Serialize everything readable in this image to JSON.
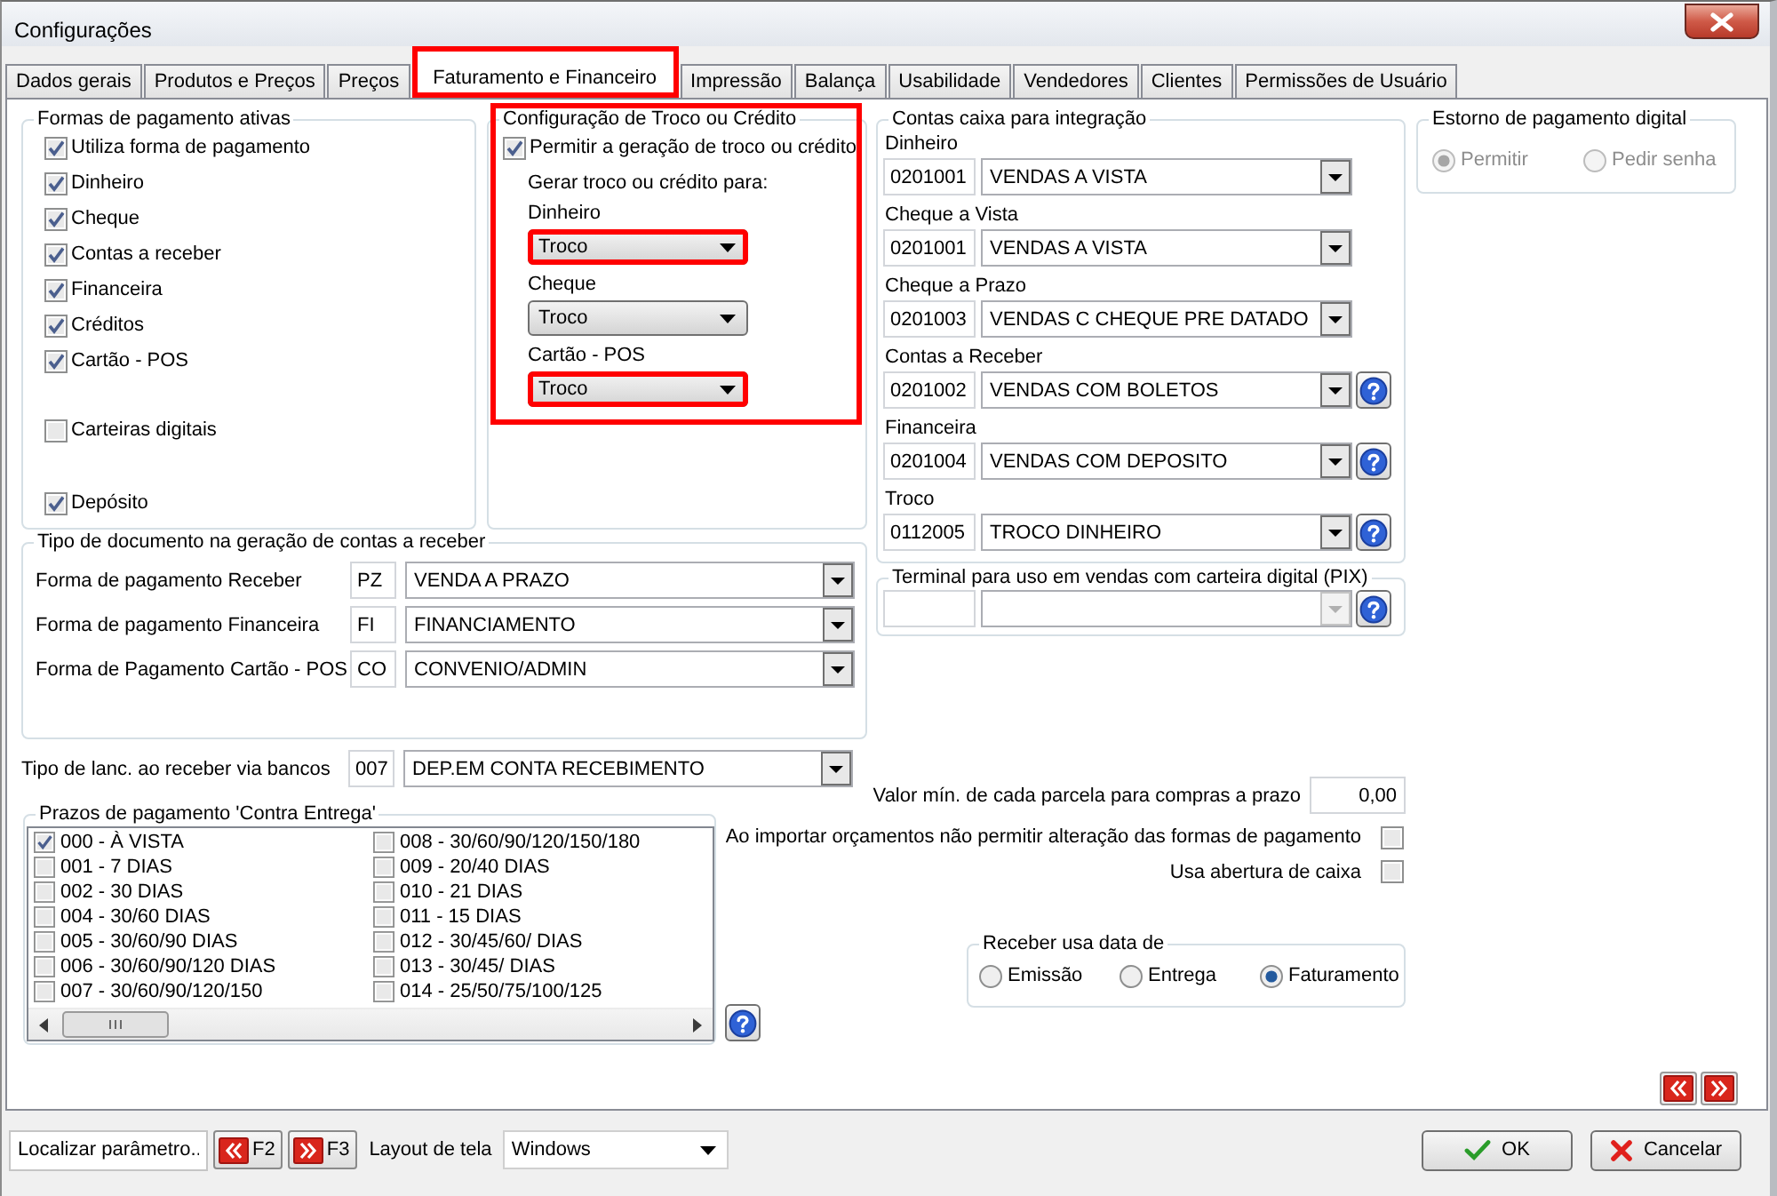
{
  "window": {
    "title": "Configurações"
  },
  "tabs": [
    {
      "label": "Dados gerais",
      "selected": false,
      "highlighted": false
    },
    {
      "label": "Produtos e Preços",
      "selected": false,
      "highlighted": false
    },
    {
      "label": "Preços",
      "selected": false,
      "highlighted": false
    },
    {
      "label": "Faturamento e Financeiro",
      "selected": true,
      "highlighted": true
    },
    {
      "label": "Impressão",
      "selected": false,
      "highlighted": false
    },
    {
      "label": "Balança",
      "selected": false,
      "highlighted": false
    },
    {
      "label": "Usabilidade",
      "selected": false,
      "highlighted": false
    },
    {
      "label": "Vendedores",
      "selected": false,
      "highlighted": false
    },
    {
      "label": "Clientes",
      "selected": false,
      "highlighted": false
    },
    {
      "label": "Permissões de Usuário",
      "selected": false,
      "highlighted": false
    }
  ],
  "payment_forms": {
    "title": "Formas de pagamento ativas",
    "items": [
      {
        "label": "Utiliza forma de pagamento",
        "checked": true
      },
      {
        "label": "Dinheiro",
        "checked": true
      },
      {
        "label": "Cheque",
        "checked": true
      },
      {
        "label": "Contas a receber",
        "checked": true
      },
      {
        "label": "Financeira",
        "checked": true
      },
      {
        "label": "Créditos",
        "checked": true
      },
      {
        "label": "Cartão - POS",
        "checked": true
      },
      {
        "label": "Carteiras digitais",
        "checked": false
      },
      {
        "label": "Depósito",
        "checked": true
      }
    ]
  },
  "change_config": {
    "title": "Configuração de Troco ou Crédito",
    "highlighted": true,
    "allow": {
      "label": "Permitir a geração de troco ou crédito",
      "checked": true
    },
    "subtitle": "Gerar troco ou crédito para:",
    "fields": [
      {
        "label": "Dinheiro",
        "value": "Troco",
        "highlighted": true
      },
      {
        "label": "Cheque",
        "value": "Troco",
        "highlighted": false
      },
      {
        "label": "Cartão - POS",
        "value": "Troco",
        "highlighted": true
      }
    ]
  },
  "cash_accounts": {
    "title": "Contas caixa para integração",
    "items": [
      {
        "label": "Dinheiro",
        "code": "0201001",
        "account": "VENDAS A VISTA",
        "has_help": false
      },
      {
        "label": "Cheque a Vista",
        "code": "0201001",
        "account": "VENDAS A VISTA",
        "has_help": false
      },
      {
        "label": "Cheque a Prazo",
        "code": "0201003",
        "account": "VENDAS C CHEQUE PRE DATADO",
        "has_help": false
      },
      {
        "label": "Contas a Receber",
        "code": "0201002",
        "account": "VENDAS COM BOLETOS",
        "has_help": true
      },
      {
        "label": "Financeira",
        "code": "0201004",
        "account": "VENDAS COM DEPOSITO",
        "has_help": true
      },
      {
        "label": "Troco",
        "code": "0112005",
        "account": "TROCO DINHEIRO",
        "has_help": true
      }
    ]
  },
  "pix_terminal": {
    "title": "Terminal para uso em vendas com carteira digital (PIX)",
    "disabled": true
  },
  "refund": {
    "title": "Estorno de pagamento digital",
    "disabled": true,
    "options": [
      {
        "label": "Permitir",
        "selected": true
      },
      {
        "label": "Pedir senha",
        "selected": false
      }
    ]
  },
  "document_types": {
    "title": "Tipo de documento na geração de contas a receber",
    "rows": [
      {
        "label": "Forma de pagamento Receber",
        "code": "PZ",
        "value": "VENDA A PRAZO"
      },
      {
        "label": "Forma de pagamento Financeira",
        "code": "FI",
        "value": "FINANCIAMENTO"
      },
      {
        "label": "Forma de Pagamento Cartão - POS",
        "code": "CO",
        "value": "CONVENIO/ADMIN"
      }
    ]
  },
  "bank_entry": {
    "label": "Tipo de lanc. ao receber via bancos",
    "code": "007",
    "value": "DEP.EM CONTA RECEBIMENTO"
  },
  "min_installment": {
    "label": "Valor mín. de cada parcela para compras a prazo",
    "value": "0,00"
  },
  "cod_terms": {
    "title": "Prazos de pagamento 'Contra Entrega'",
    "items": [
      {
        "label": "000 - À VISTA",
        "checked": true
      },
      {
        "label": "001 - 7 DIAS",
        "checked": false
      },
      {
        "label": "002 - 30 DIAS",
        "checked": false
      },
      {
        "label": "004 - 30/60 DIAS",
        "checked": false
      },
      {
        "label": "005 - 30/60/90 DIAS",
        "checked": false
      },
      {
        "label": "006 - 30/60/90/120 DIAS",
        "checked": false
      },
      {
        "label": "007 - 30/60/90/120/150",
        "checked": false
      },
      {
        "label": "008 - 30/60/90/120/150/180",
        "checked": false
      },
      {
        "label": "009 - 20/40 DIAS",
        "checked": false
      },
      {
        "label": "010 - 21 DIAS",
        "checked": false
      },
      {
        "label": "011 - 15 DIAS",
        "checked": false
      },
      {
        "label": "012 - 30/45/60/ DIAS",
        "checked": false
      },
      {
        "label": "013 - 30/45/ DIAS",
        "checked": false
      },
      {
        "label": "014 - 25/50/75/100/125",
        "checked": false
      }
    ]
  },
  "options": [
    {
      "label": "Ao importar orçamentos não permitir alteração das formas de pagamento",
      "checked": false
    },
    {
      "label": "Usa abertura de caixa",
      "checked": false
    }
  ],
  "receive_date": {
    "title": "Receber usa data de",
    "options": [
      {
        "label": "Emissão",
        "selected": false
      },
      {
        "label": "Entrega",
        "selected": false
      },
      {
        "label": "Faturamento",
        "selected": true
      }
    ]
  },
  "footer": {
    "search": {
      "placeholder": "Localizar parâmetro.."
    },
    "find_buttons": [
      {
        "key": "F2",
        "kind": "previous"
      },
      {
        "key": "F3",
        "kind": "next"
      }
    ],
    "layout": {
      "label": "Layout de tela",
      "value": "Windows"
    },
    "buttons": [
      {
        "label": "OK",
        "kind": "ok"
      },
      {
        "label": "Cancelar",
        "kind": "cancel"
      }
    ]
  }
}
